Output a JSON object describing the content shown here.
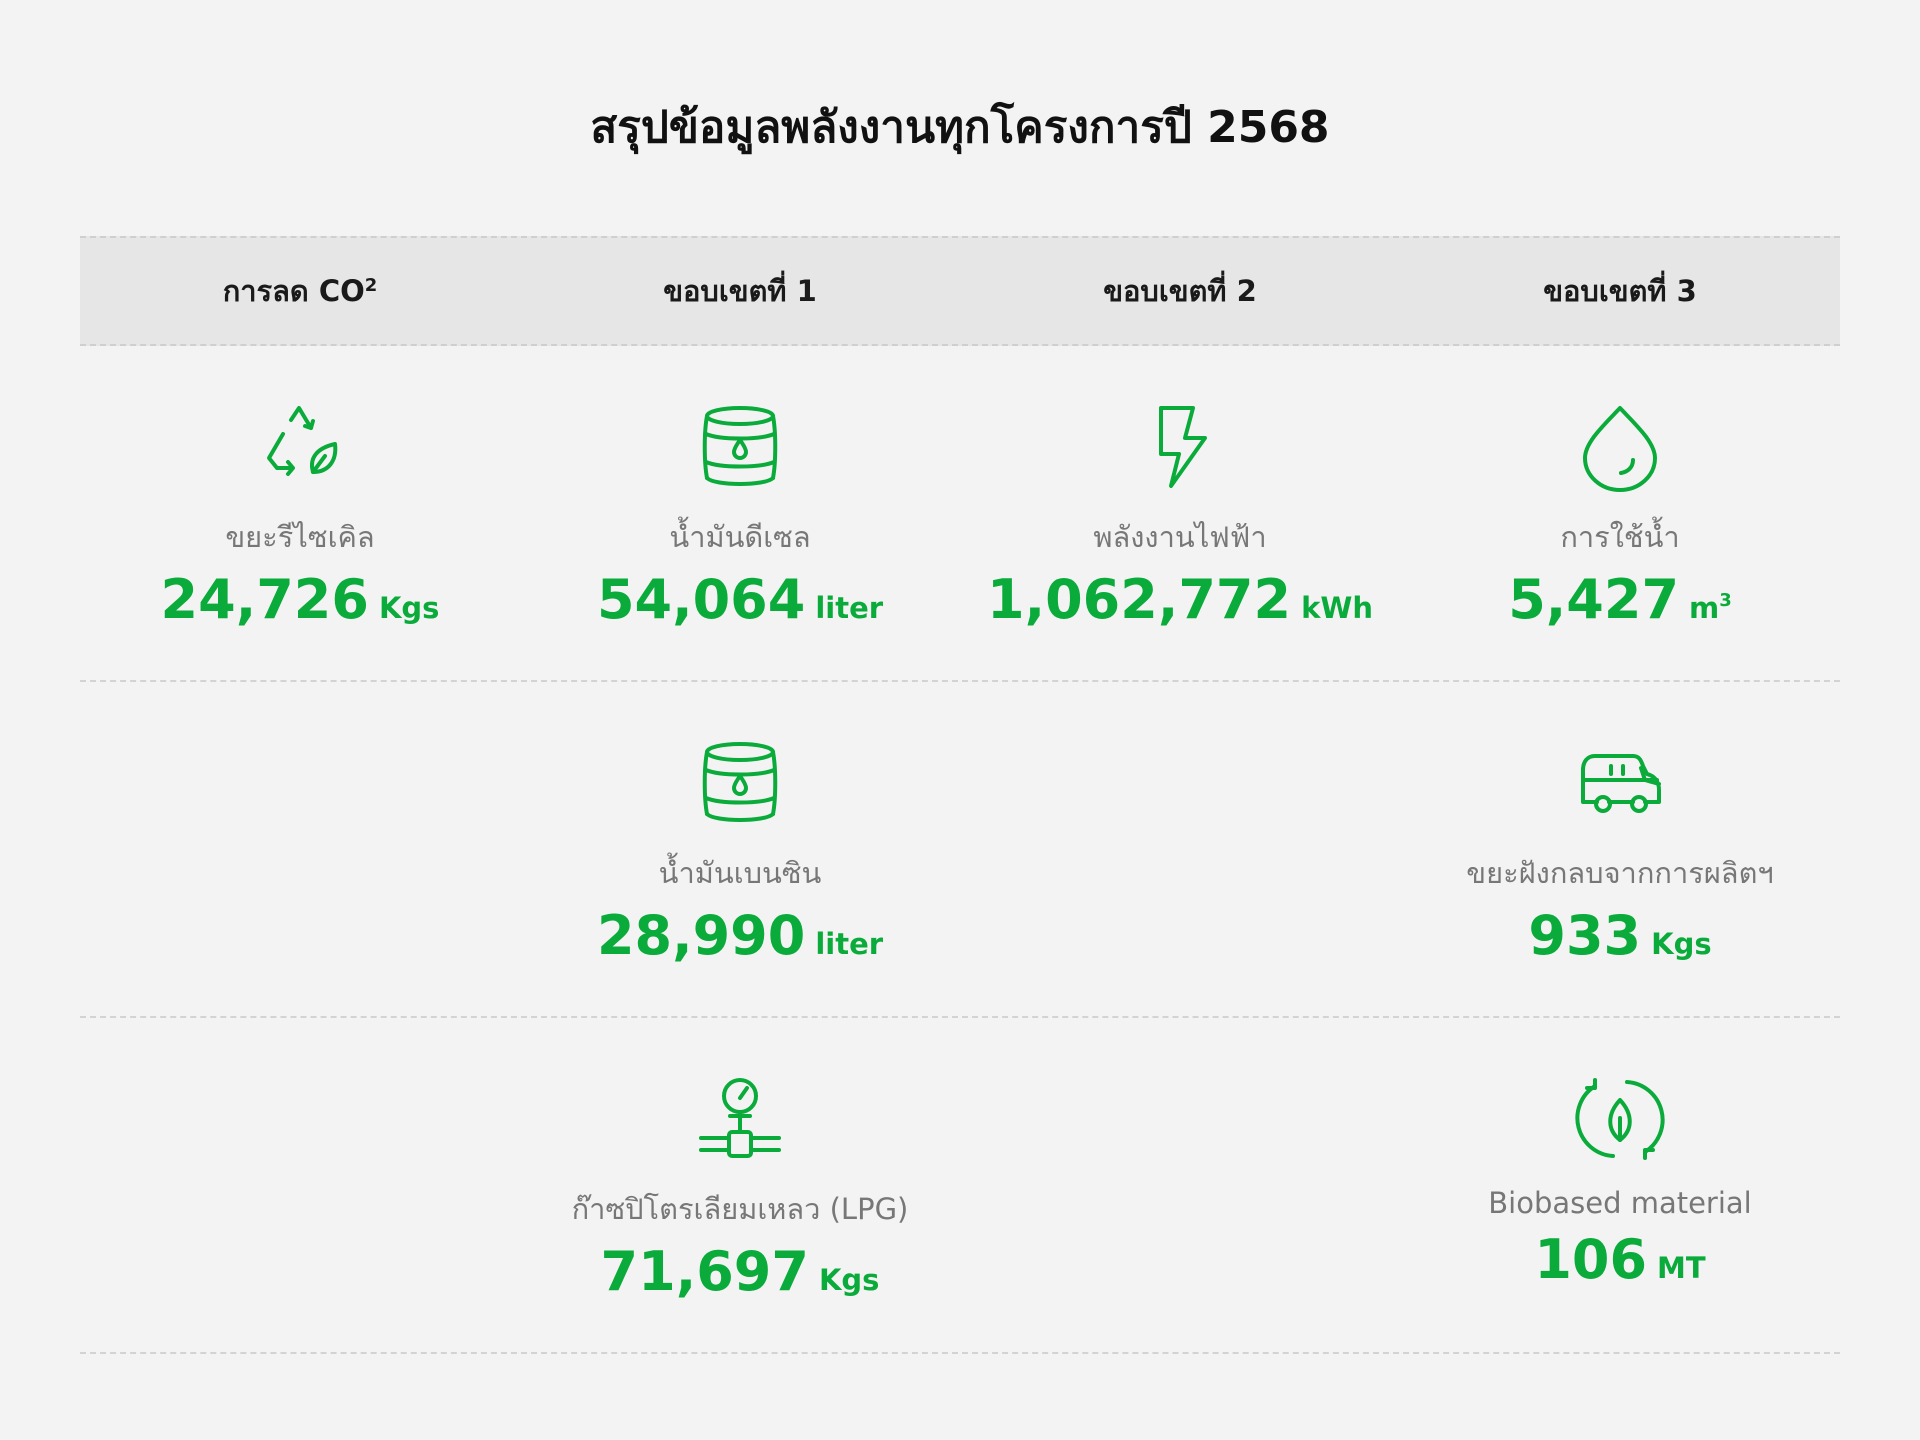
{
  "title": "สรุปข้อมูลพลังงานทุกโครงการปี 2568",
  "colors": {
    "accent": "#0aab3b",
    "label": "#777777",
    "header_bg": "#e6e6e6"
  },
  "headers": {
    "co2_base": "การลด CO",
    "co2_sup": "2",
    "scope1": "ขอบเขตที่ 1",
    "scope2": "ขอบเขตที่ 2",
    "scope3": "ขอบเขตที่ 3"
  },
  "items": {
    "recycle": {
      "icon": "recycle-leaf-icon",
      "label": "ขยะรีไซเคิล",
      "value": "24,726",
      "unit": "Kgs"
    },
    "diesel": {
      "icon": "oil-barrel-icon",
      "label": "น้ำมันดีเซล",
      "value": "54,064",
      "unit": "liter"
    },
    "electricity": {
      "icon": "lightning-icon",
      "label": "พลังงานไฟฟ้า",
      "value": "1,062,772",
      "unit": "kWh"
    },
    "water": {
      "icon": "water-drop-icon",
      "label": "การใช้น้ำ",
      "value": "5,427",
      "unit": "m",
      "unit_sup": "3"
    },
    "gasoline": {
      "icon": "oil-barrel-icon",
      "label": "น้ำมันเบนซิน",
      "value": "28,990",
      "unit": "liter"
    },
    "landfill": {
      "icon": "truck-icon",
      "label": "ขยะฝังกลบจากการผลิตฯ",
      "value": "933",
      "unit": "Kgs"
    },
    "lpg": {
      "icon": "gas-gauge-icon",
      "label": "ก๊าซปิโตรเลียมเหลว (LPG)",
      "value": "71,697",
      "unit": "Kgs"
    },
    "biobased": {
      "icon": "bio-cycle-icon",
      "label": "Biobased material",
      "value": "106",
      "unit": "MT"
    }
  }
}
